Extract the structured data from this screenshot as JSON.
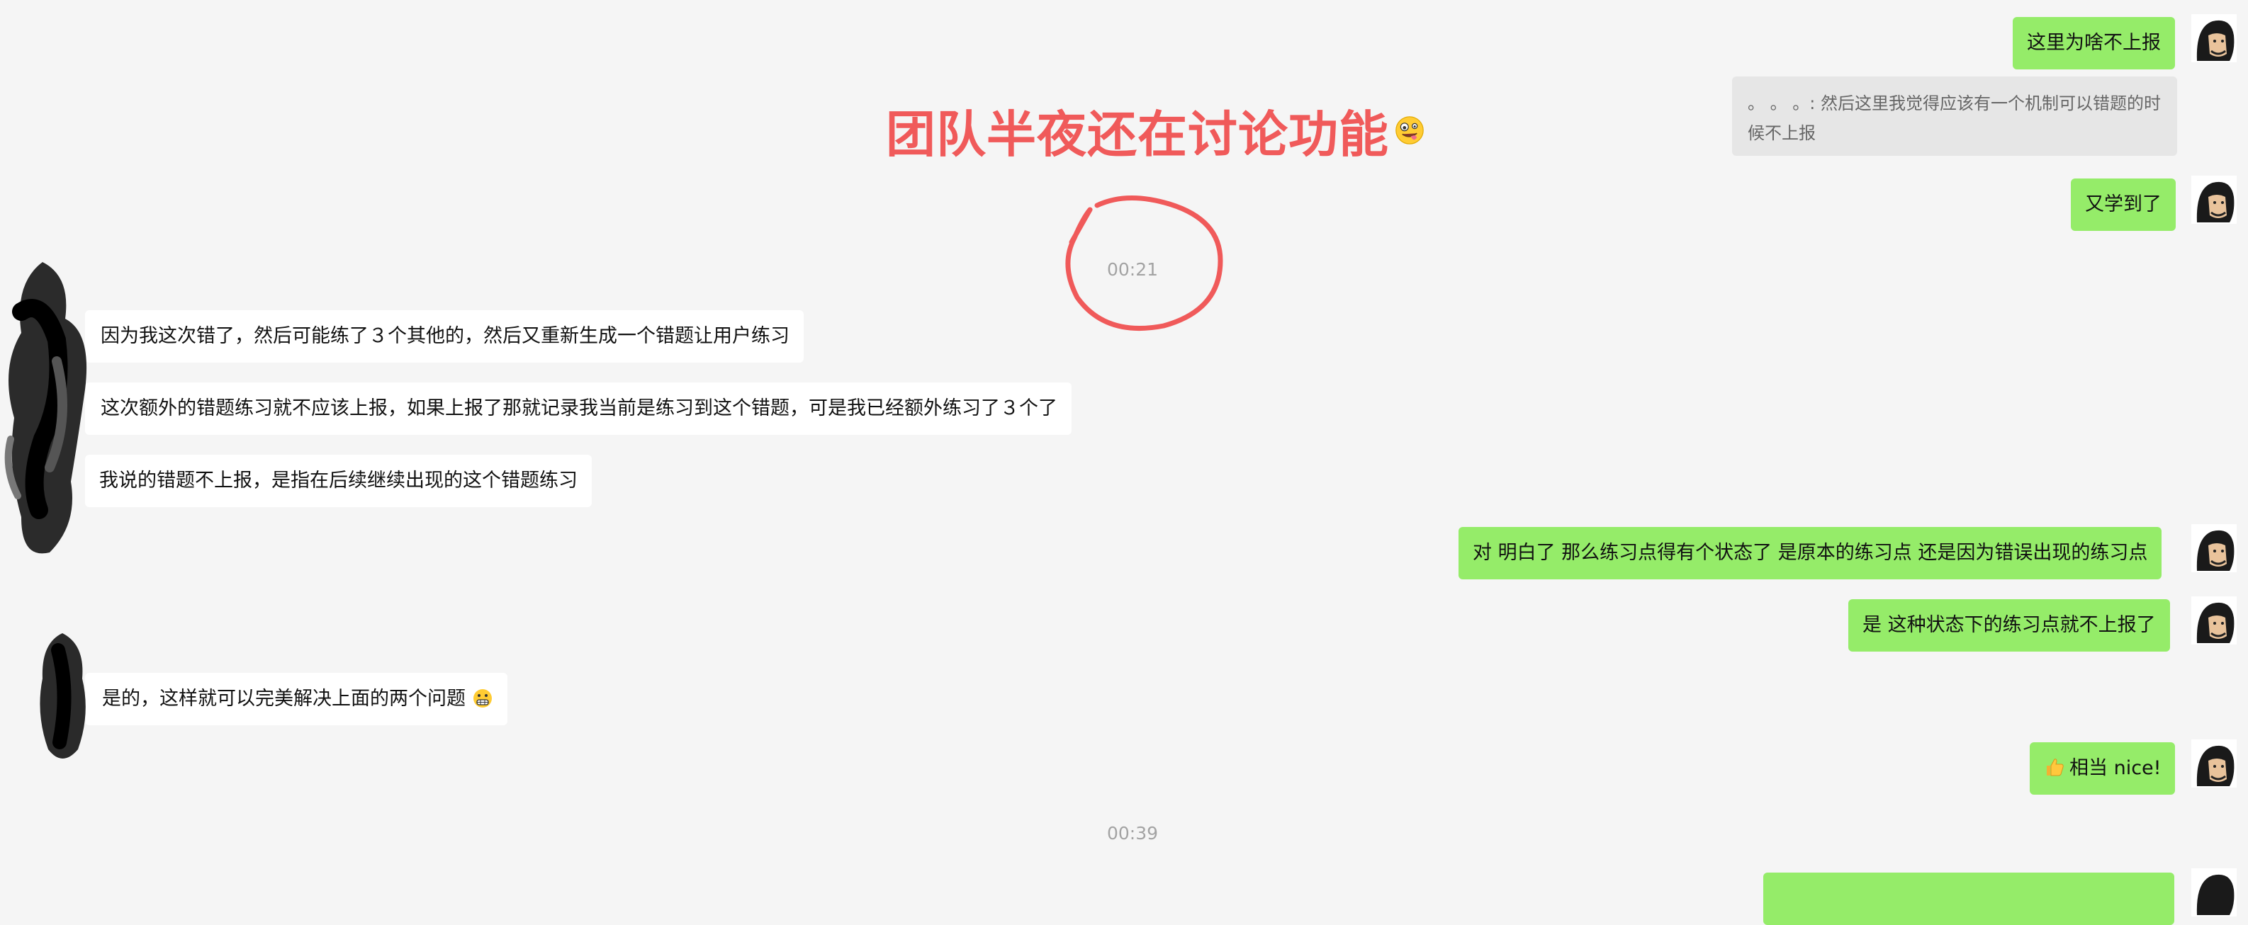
{
  "title_overlay": {
    "text": "团队半夜还在讨论功能",
    "emoji_icon": "zany-face-emoji"
  },
  "timestamps": {
    "first": "00:21",
    "second": "00:39"
  },
  "messages": {
    "m1": "这里为啥不上报",
    "quote": "。 。 。: 然后这里我觉得应该有一个机制可以错题的时候不上报",
    "m2": "又学到了",
    "m3": "因为我这次错了，然后可能练了３个其他的，然后又重新生成一个错题让用户练习",
    "m4": "这次额外的错题练习就不应该上报，如果上报了那就记录我当前是练习到这个错题，可是我已经额外练习了３个了",
    "m5": "我说的错题不上报，是指在后续继续出现的这个错题练习",
    "m6": "对 明白了 那么练习点得有个状态了 是原本的练习点 还是因为错误出现的练习点",
    "m7": "是 这种状态下的练习点就不上报了",
    "m8": "是的，这样就可以完美解决上面的两个问题",
    "m8_emoji": "grimacing-face-emoji",
    "m9": "相当 nice!",
    "m9_emoji": "thumbs-up-emoji"
  },
  "colors": {
    "background": "#f5f5f5",
    "outgoing_bubble": "#95ec69",
    "incoming_bubble": "#ffffff",
    "quote_bg": "#e6e6e6",
    "annotation_red": "#f05a5a"
  }
}
